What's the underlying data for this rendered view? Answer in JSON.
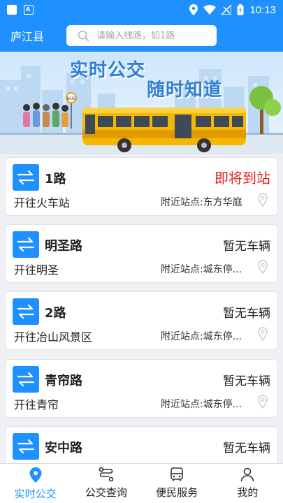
{
  "status_bar": {
    "left_icons": [
      "photo-icon",
      "a-icon"
    ],
    "right_icons": [
      "location-icon",
      "wifi-icon",
      "no-signal-icon",
      "battery-icon"
    ],
    "time": "10:13"
  },
  "header": {
    "city": "庐江县",
    "search_placeholder": "请输入线路，如1路",
    "accent_color": "#1e90ff"
  },
  "banner": {
    "title_left": "实时公交",
    "title_right": "随时知道",
    "bus_label": "BUS"
  },
  "routes": [
    {
      "name": "1路",
      "status": "即将到站",
      "direction": "开往火车站",
      "nearby": "附近站点:东方华庭"
    },
    {
      "name": "明圣路",
      "status": "暂无车辆",
      "direction": "开往明圣",
      "nearby": "附近站点:城东停..."
    },
    {
      "name": "2路",
      "status": "暂无车辆",
      "direction": "开往冶山风景区",
      "nearby": "附近站点:城东停..."
    },
    {
      "name": "青帘路",
      "status": "暂无车辆",
      "direction": "开往青帘",
      "nearby": "附近站点:城东停..."
    },
    {
      "name": "安中路",
      "status": "暂无车辆",
      "direction": "",
      "nearby": ""
    }
  ],
  "status_colors": {
    "arriving": "#e0221e",
    "none": "#222222"
  },
  "nav": [
    {
      "label": "实时公交",
      "icon": "map-pin-icon",
      "active": true
    },
    {
      "label": "公交查询",
      "icon": "route-icon",
      "active": false
    },
    {
      "label": "便民服务",
      "icon": "bus-icon",
      "active": false
    },
    {
      "label": "我的",
      "icon": "user-icon",
      "active": false
    }
  ]
}
